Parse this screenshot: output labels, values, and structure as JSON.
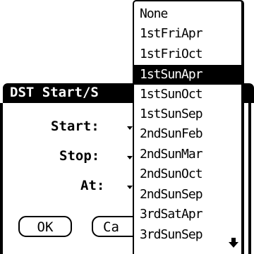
{
  "dialog": {
    "title": "DST Start/S",
    "fields": [
      {
        "label": "Start:"
      },
      {
        "label": "Stop:"
      },
      {
        "label": "At:"
      }
    ],
    "buttons": {
      "ok": "OK",
      "cancel": "Ca"
    }
  },
  "popup": {
    "items": [
      "None",
      "1stFriApr",
      "1stFriOct",
      "1stSunApr",
      "1stSunOct",
      "1stSunSep",
      "2ndSunFeb",
      "2ndSunMar",
      "2ndSunOct",
      "2ndSunSep",
      "3rdSatApr",
      "3rdSunSep"
    ],
    "selected_index": 3,
    "scroll_icon": "scroll-down-arrow-icon"
  }
}
